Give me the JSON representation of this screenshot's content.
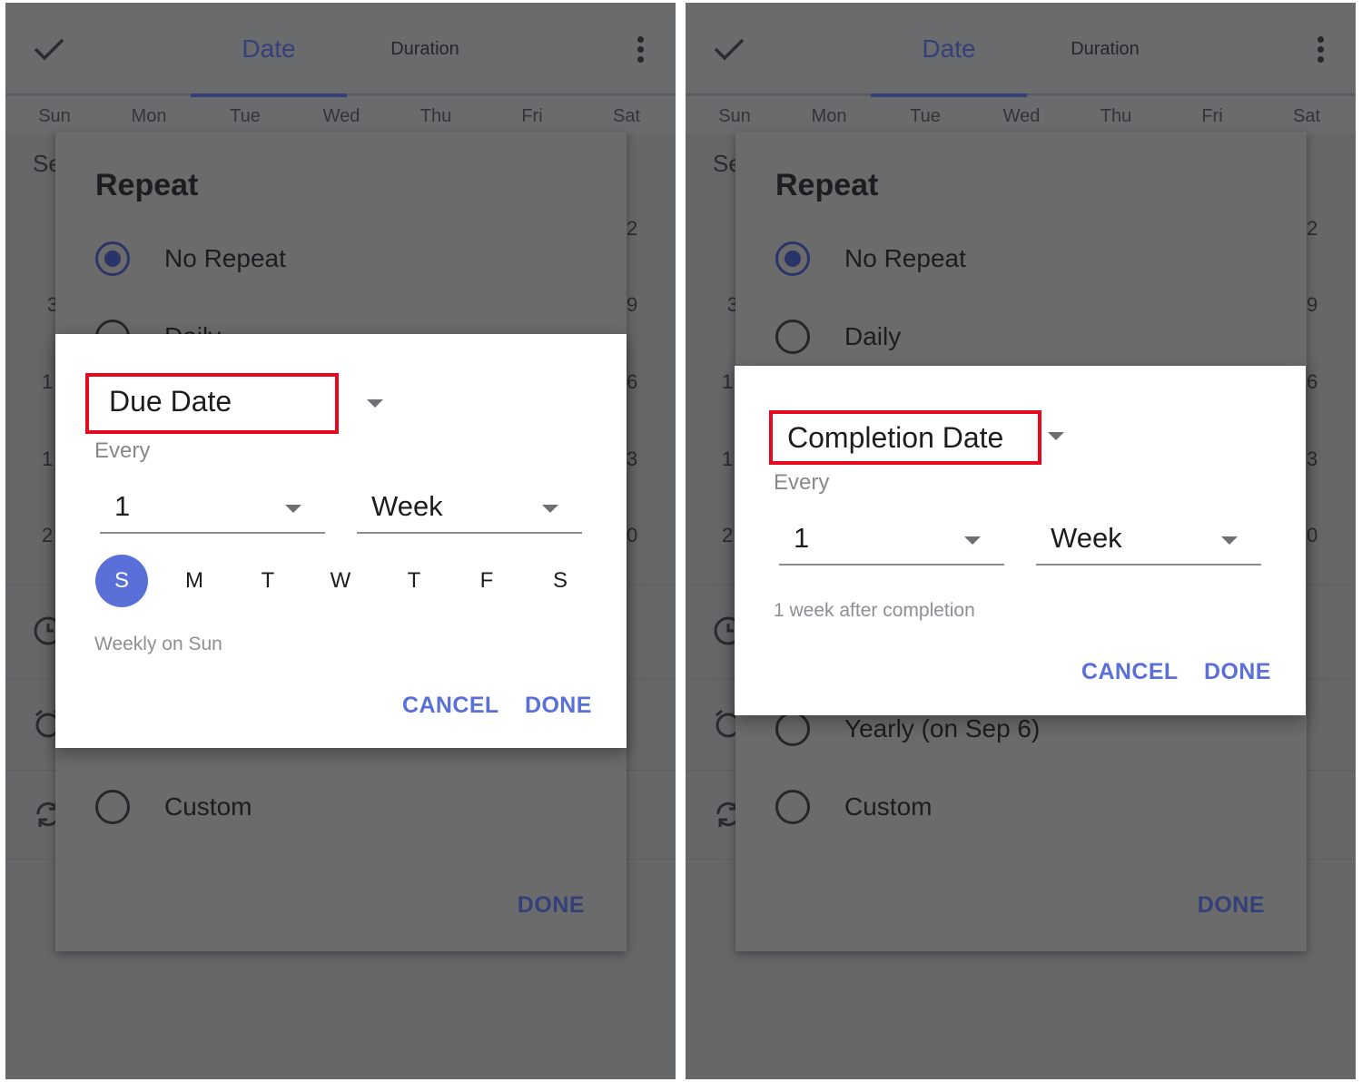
{
  "topbar": {
    "tab_date": "Date",
    "tab_duration": "Duration"
  },
  "weekdays": [
    "Sun",
    "Mon",
    "Tue",
    "Wed",
    "Thu",
    "Fri",
    "Sat"
  ],
  "background": {
    "section_fragment": "Se",
    "row_left_numbers": [
      "3",
      "1",
      "1",
      "2"
    ],
    "row_right_numbers": [
      "2",
      "9",
      "6",
      "3",
      "0"
    ]
  },
  "repeat_dialog": {
    "title": "Repeat",
    "options": [
      "No Repeat",
      "Daily",
      "Yearly (on Sep 6)",
      "Custom"
    ],
    "done": "DONE"
  },
  "left_subdialog": {
    "base": "Due Date",
    "every_label": "Every",
    "interval": "1",
    "unit": "Week",
    "day_letters": [
      "S",
      "M",
      "T",
      "W",
      "T",
      "F",
      "S"
    ],
    "selected_day_index": 0,
    "summary": "Weekly on Sun",
    "cancel": "CANCEL",
    "done": "DONE"
  },
  "right_subdialog": {
    "base": "Completion Date",
    "every_label": "Every",
    "interval": "1",
    "unit": "Week",
    "summary": "1 week after completion",
    "cancel": "CANCEL",
    "done": "DONE"
  },
  "colors": {
    "accent": "#5a6fd8",
    "highlight": "#e8081d",
    "overlay": "#666769",
    "tab_active": "#34407a"
  }
}
